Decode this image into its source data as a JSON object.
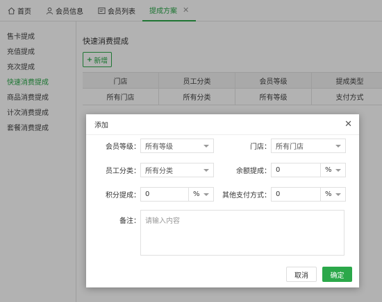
{
  "top_tabs": [
    {
      "label": "首页",
      "icon": "home-icon"
    },
    {
      "label": "会员信息",
      "icon": "user-icon"
    },
    {
      "label": "会员列表",
      "icon": "card-icon"
    },
    {
      "label": "提成方案",
      "close": "✕"
    }
  ],
  "sidebar": {
    "items": [
      {
        "label": "售卡提成"
      },
      {
        "label": "充值提成"
      },
      {
        "label": "充次提成"
      },
      {
        "label": "快速消费提成"
      },
      {
        "label": "商品消费提成"
      },
      {
        "label": "计次消费提成"
      },
      {
        "label": "套餐消费提成"
      }
    ]
  },
  "main": {
    "title": "快速消费提成",
    "add_label": "新增",
    "table": {
      "headers": [
        "门店",
        "员工分类",
        "会员等级",
        "提成类型"
      ],
      "rows": [
        [
          "所有门店",
          "所有分类",
          "所有等级",
          "支付方式"
        ]
      ]
    }
  },
  "modal": {
    "title": "添加",
    "close": "✕",
    "member_level": {
      "label": "会员等级：",
      "value": "所有等级"
    },
    "store": {
      "label": "门店：",
      "value": "所有门店"
    },
    "staff_category": {
      "label": "员工分类：",
      "value": "所有分类"
    },
    "balance_commission": {
      "label": "余额提成：",
      "value": "0",
      "unit": "%"
    },
    "points_commission": {
      "label": "积分提成：",
      "value": "0",
      "unit": "%"
    },
    "other_payment": {
      "label": "其他支付方式：",
      "value": "0",
      "unit": "%"
    },
    "remark": {
      "label": "备注：",
      "placeholder": "请输入内容"
    },
    "cancel_label": "取消",
    "ok_label": "确定"
  },
  "colors": {
    "accent": "#2ba84a"
  }
}
